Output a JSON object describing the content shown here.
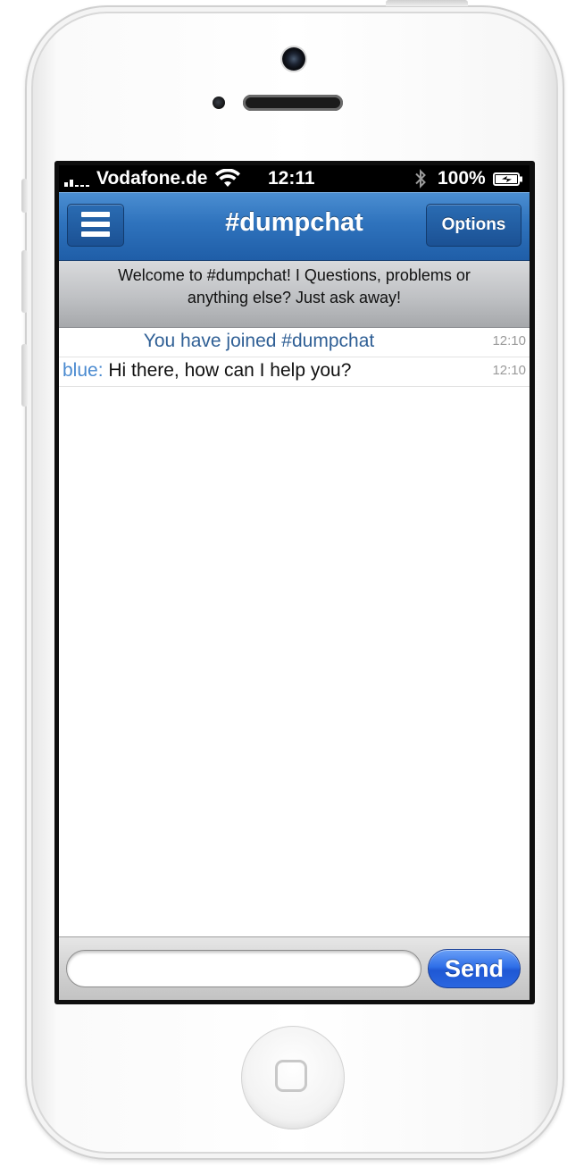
{
  "status_bar": {
    "carrier": "Vodafone.de",
    "time": "12:11",
    "battery": "100%"
  },
  "nav": {
    "title": "#dumpchat",
    "options_label": "Options"
  },
  "topic": {
    "text": "Welcome to #dumpchat! I Questions, problems or anything else? Just ask away!"
  },
  "messages": [
    {
      "type": "system",
      "text": "You have joined #dumpchat",
      "time": "12:10"
    },
    {
      "type": "user",
      "nick": "blue:",
      "text": "Hi there, how can I help you?",
      "time": "12:10"
    }
  ],
  "input": {
    "value": "",
    "placeholder": ""
  },
  "send_label": "Send",
  "colors": {
    "nav_blue": "#2f73bd",
    "send_blue": "#2f6fe8",
    "nick_blue": "#4a8ad0",
    "system_text": "#2f5f95"
  },
  "icons": [
    "menu-icon",
    "wifi-icon",
    "bluetooth-icon",
    "battery-icon",
    "signal-icon"
  ]
}
